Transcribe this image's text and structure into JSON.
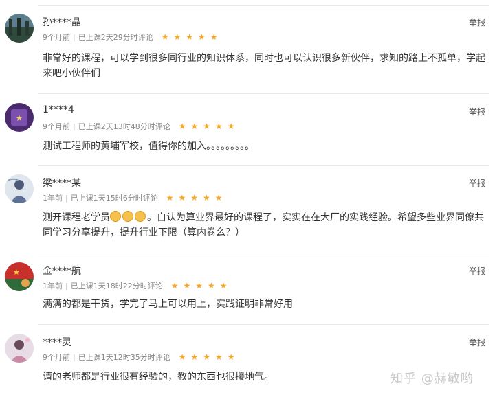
{
  "report_label": "举报",
  "star_color": "#f5a623",
  "reviews": [
    {
      "name": "孙****晶",
      "time": "9个月前",
      "progress": "已上课2天29分时评论",
      "rating": 5,
      "content": "非常好的课程，可以学到很多同行业的知识体系，同时也可以认识很多新伙伴，求知的路上不孤单，学起来吧小伙伴们"
    },
    {
      "name": "1****4",
      "time": "9个月前",
      "progress": "已上课2天13时48分时评论",
      "rating": 5,
      "content": "测试工程师的黄埔军校，值得你的加入。。。。。。。。。"
    },
    {
      "name": "梁****某",
      "time": "1年前",
      "progress": "已上课1天15时6分时评论",
      "rating": 5,
      "content_prefix": "测开课程老学员",
      "content_emoji_count": 3,
      "content": "。自认为算业界最好的课程了，实实在在大厂的实践经验。希望多些业界同僚共同学习分享提升，提升行业下限（算内卷么？）"
    },
    {
      "name": "金****航",
      "time": "1年前",
      "progress": "已上课1天18时22分时评论",
      "rating": 5,
      "content": "满满的都是干货，学完了马上可以用上，实践证明非常好用"
    },
    {
      "name": "****灵",
      "time": "9个月前",
      "progress": "已上课1天12时35分时评论",
      "rating": 5,
      "content": "请的老师都是行业很有经验的，教的东西也很接地气。"
    }
  ],
  "watermark": "知乎 @赫敏哟"
}
